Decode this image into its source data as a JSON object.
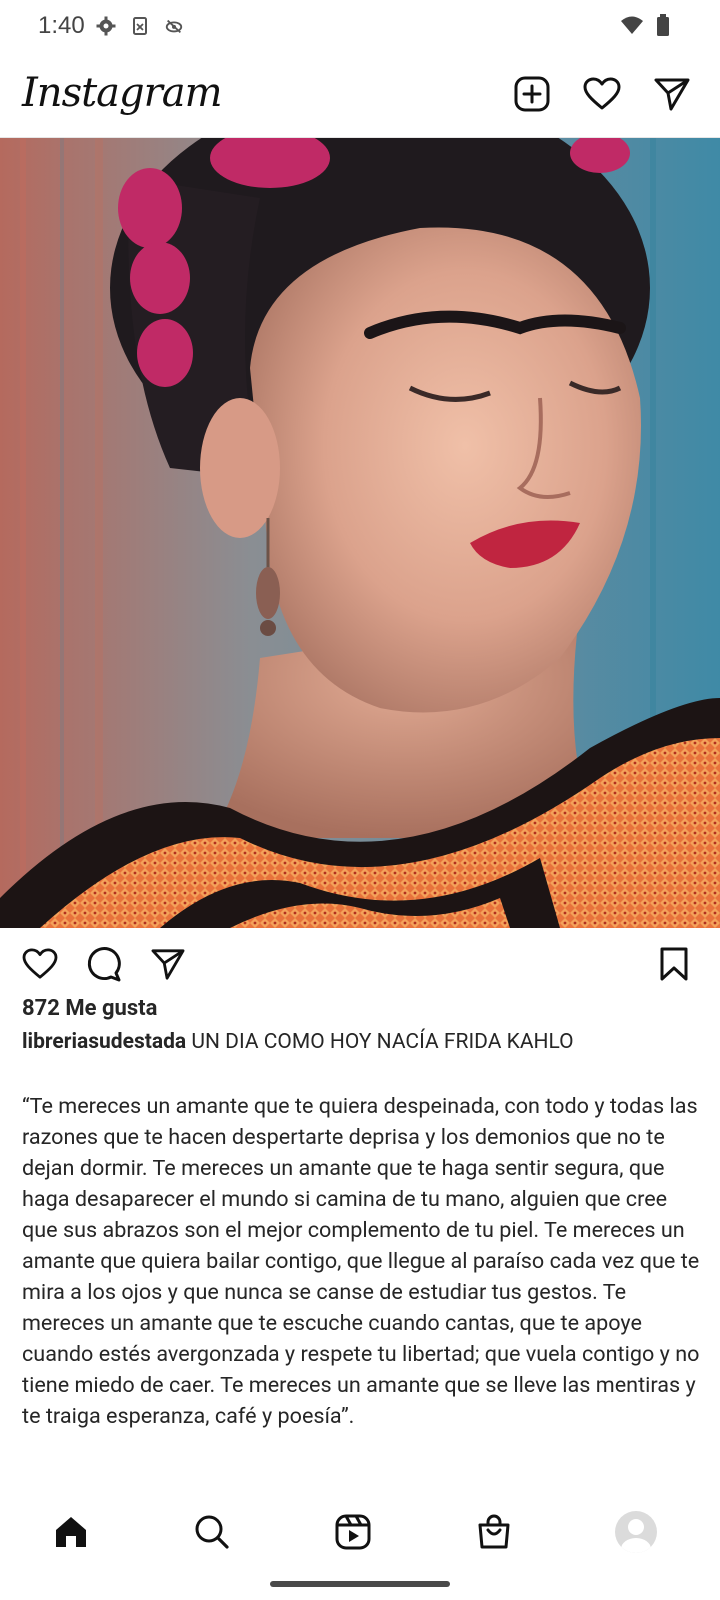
{
  "status_bar": {
    "time": "1:40",
    "icons_left": [
      "settings-icon",
      "sim-icon",
      "eye-off-icon"
    ],
    "icons_right": [
      "wifi-icon",
      "battery-icon"
    ]
  },
  "header": {
    "logo_text": "Instagram",
    "actions": [
      "new-post-icon",
      "heart-icon",
      "direct-message-icon"
    ]
  },
  "post": {
    "image_description": "",
    "likes_text": "872 Me gusta",
    "username": "libreriasudestada",
    "caption_title": "UN DIA COMO HOY NACÍA FRIDA KAHLO",
    "caption_body": "“Te mereces un amante que te quiera despeinada, con todo y todas las razones que te hacen despertarte deprisa y los demonios que no te dejan dormir. Te mereces un amante que te haga sentir segura, que haga desaparecer el mundo si camina de tu mano, alguien que cree que sus abrazos son el mejor complemento de tu piel. Te mereces un amante que quiera bailar contigo, que llegue al paraíso cada vez que te mira a los ojos y que nunca se canse de estudiar tus gestos. Te mereces un amante que te escuche cuando cantas, que te apoye cuando estés avergonzada y respete tu libertad; que vuela contigo y no tiene miedo de caer. Te mereces un amante que se lleve las mentiras y te traiga esperanza, café y poesía”."
  },
  "bottom_nav": [
    "home-icon",
    "search-icon",
    "reels-icon",
    "shop-icon",
    "profile-avatar"
  ],
  "colors": {
    "text": "#262626",
    "divider": "#e6e6e6",
    "icon": "#111111"
  }
}
